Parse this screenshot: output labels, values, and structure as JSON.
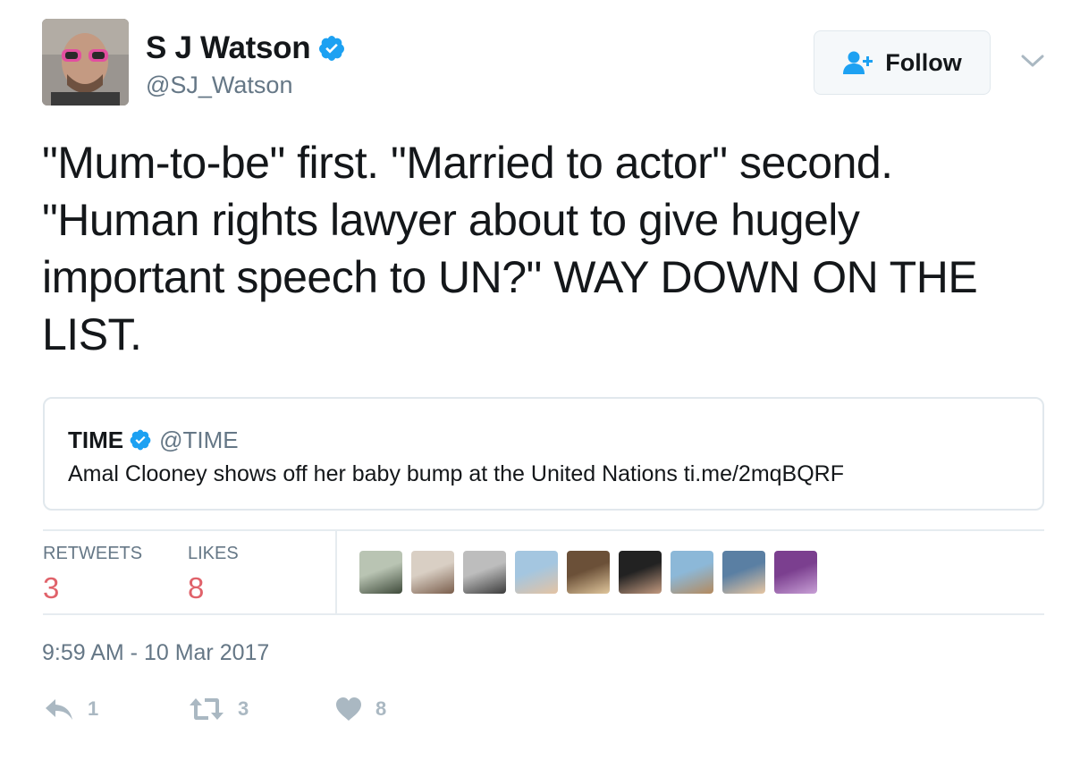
{
  "author": {
    "name": "S J Watson",
    "handle": "@SJ_Watson",
    "avatar_icon": "profile-photo",
    "verified_icon": "verified-badge-icon"
  },
  "follow_button": {
    "label": "Follow",
    "icon": "add-user-icon"
  },
  "tweet": {
    "text": "\"Mum-to-be\" first. \"Married to actor\" second. \"Human rights lawyer about to give hugely important speech to UN?\" WAY DOWN ON THE LIST."
  },
  "quoted_tweet": {
    "name": "TIME",
    "handle": "@TIME",
    "text": "Amal Clooney shows off her baby bump at the United Nations ti.me/2mqBQRF"
  },
  "stats": {
    "retweets_label": "RETWEETS",
    "retweets_value": "3",
    "likes_label": "LIKES",
    "likes_value": "8"
  },
  "likers": [
    {
      "color_a": "#b9c4b3",
      "color_b": "#3e4a3a"
    },
    {
      "color_a": "#d9cfc4",
      "color_b": "#7a5e4c"
    },
    {
      "color_a": "#bdbdbd",
      "color_b": "#3c3c3c"
    },
    {
      "color_a": "#a4c6e0",
      "color_b": "#e4c3a3"
    },
    {
      "color_a": "#6b5038",
      "color_b": "#e0c69c"
    },
    {
      "color_a": "#222222",
      "color_b": "#c39a80"
    },
    {
      "color_a": "#8cb8d8",
      "color_b": "#b48a5e"
    },
    {
      "color_a": "#5a7fa3",
      "color_b": "#e7c6a2"
    },
    {
      "color_a": "#7b3f8f",
      "color_b": "#c8a0d6"
    }
  ],
  "timestamp": "9:59 AM - 10 Mar 2017",
  "actions": {
    "reply_count": "1",
    "retweet_count": "3",
    "like_count": "8"
  },
  "colors": {
    "verified_blue": "#1da1f2",
    "stat_value": "#e0626a",
    "muted": "#657786",
    "border": "#e1e8ed",
    "action_gray": "#aab8c2"
  }
}
